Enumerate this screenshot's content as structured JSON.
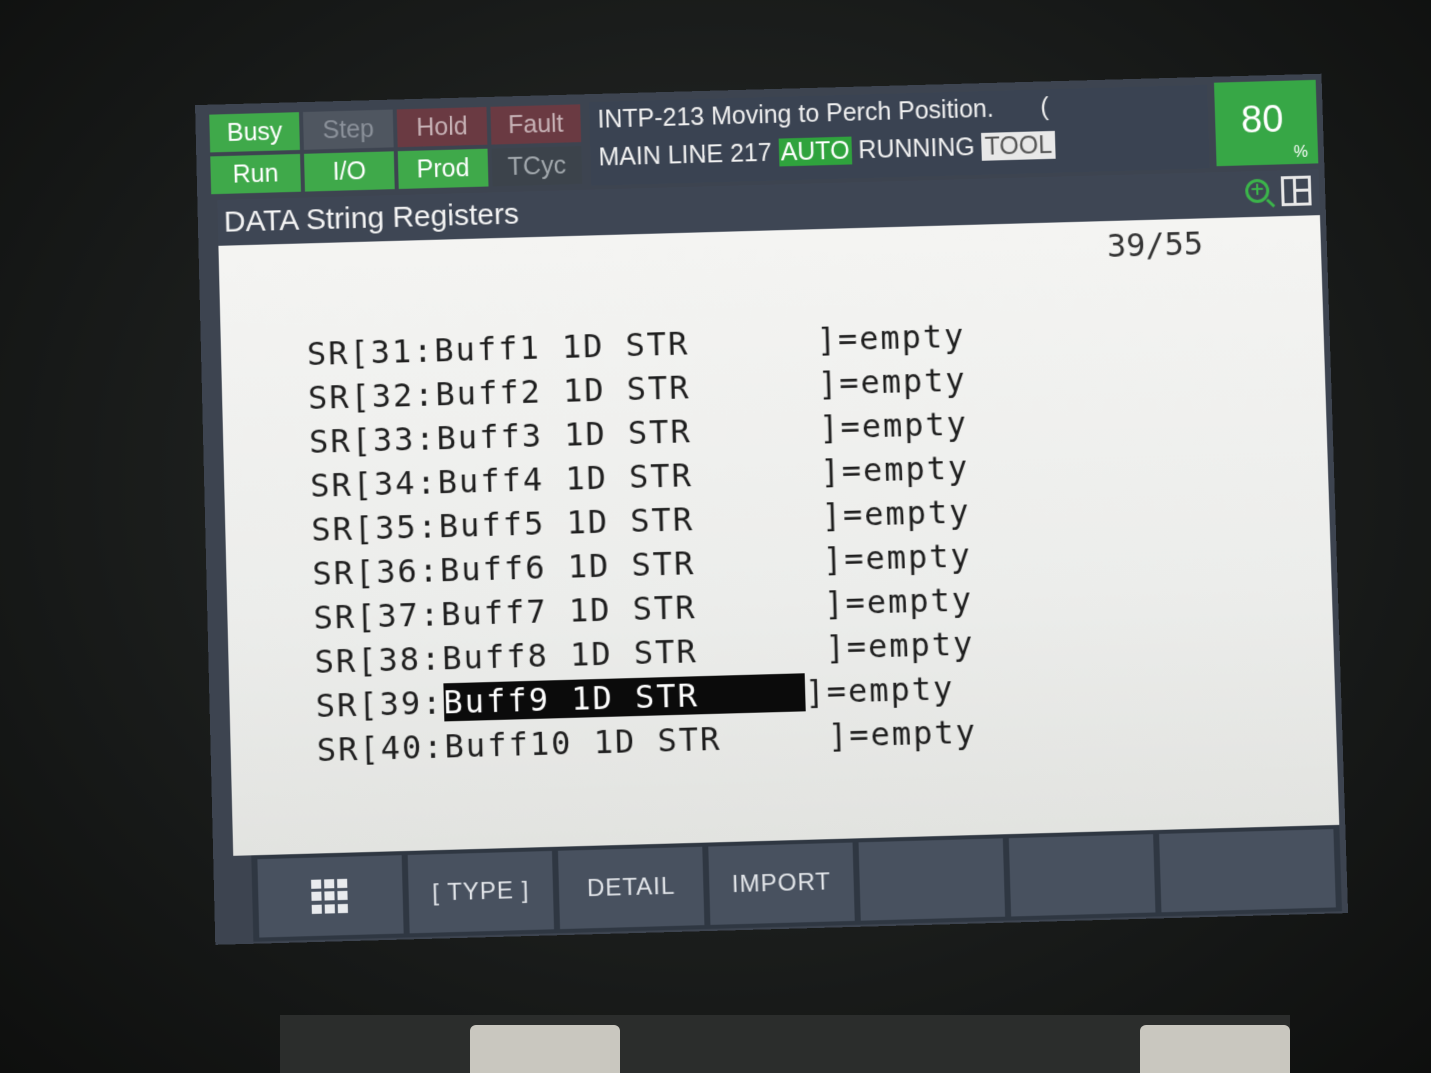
{
  "status": {
    "busy": "Busy",
    "step": "Step",
    "hold": "Hold",
    "fault": "Fault",
    "run": "Run",
    "io": "I/O",
    "prod": "Prod",
    "tcyc": "TCyc"
  },
  "message": {
    "line1": "INTP-213 Moving to Perch Position.",
    "line1_tail": "(",
    "line2_prefix": "MAIN LINE 217",
    "line2_auto": "AUTO",
    "line2_running": "RUNNING",
    "line2_tool": "TOOL"
  },
  "override": {
    "value": "80",
    "unit": "%"
  },
  "title": "DATA String Registers",
  "position": "39/55",
  "registers": [
    "SR[31:Buff1 1D STR      ]=empty",
    "SR[32:Buff2 1D STR      ]=empty",
    "SR[33:Buff3 1D STR      ]=empty",
    "SR[34:Buff4 1D STR      ]=empty",
    "SR[35:Buff5 1D STR      ]=empty",
    "SR[36:Buff6 1D STR      ]=empty",
    "SR[37:Buff7 1D STR      ]=empty",
    "SR[38:Buff8 1D STR      ]=empty",
    "SR[40:Buff10 1D STR     ]=empty"
  ],
  "selected_row": {
    "prefix": "SR[39:",
    "selected": "Buff9 1D STR     ",
    "suffix": "]=empty"
  },
  "function_keys": {
    "f1": "[ TYPE ]",
    "f2": "DETAIL",
    "f3": "IMPORT",
    "f4": "",
    "f5": ""
  },
  "colors": {
    "status_on": "#3fa94a",
    "highlight": "#0b0b0b",
    "screen_bg": "#f4f4f2"
  },
  "icons": [
    "menu-grid-icon",
    "zoom-in-icon",
    "layout-split-icon"
  ]
}
